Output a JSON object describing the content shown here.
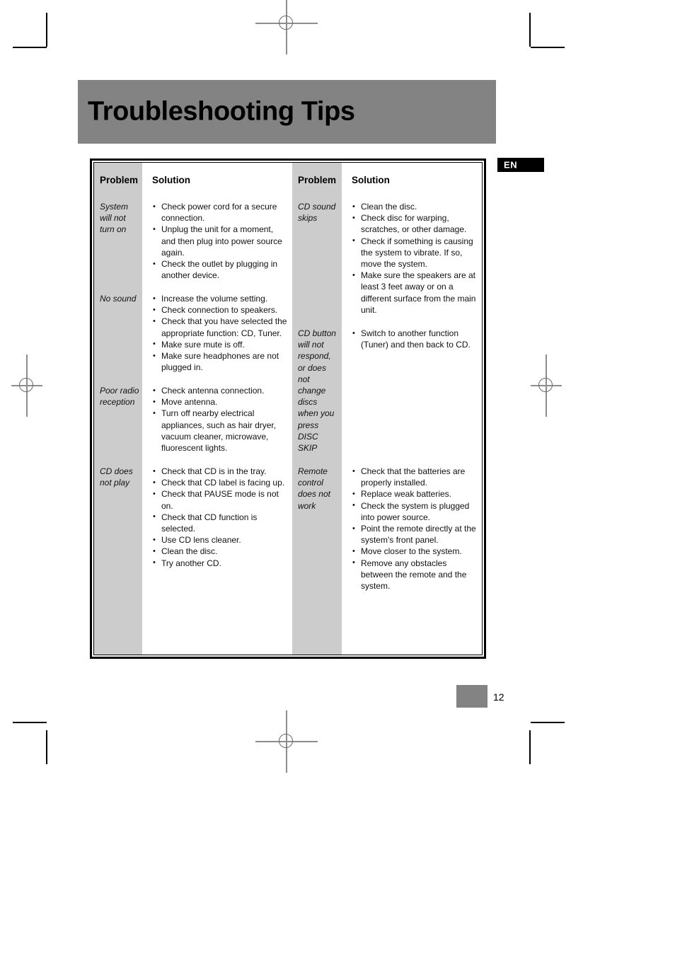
{
  "page": {
    "title": "Troubleshooting Tips",
    "language_badge": "EN",
    "page_number": "12",
    "colors": {
      "banner_gray": "#838383",
      "problem_column_gray": "#cccccc",
      "page_tab_gray": "#838383",
      "badge_black": "#000000"
    }
  },
  "table": {
    "headers": {
      "problem": "Problem",
      "solution": "Solution"
    },
    "left_column": [
      {
        "problem": "System will not turn on",
        "solutions": [
          "Check power cord for a secure connection.",
          "Unplug the unit for a moment, and then plug into power source again.",
          "Check the outlet by plugging in another device."
        ]
      },
      {
        "problem": "No sound",
        "solutions": [
          "Increase the volume setting.",
          "Check connection to speakers.",
          "Check that you have selected the appropriate function: CD, Tuner.",
          "Make sure mute is off.",
          "Make sure headphones are not plugged in."
        ]
      },
      {
        "problem": "Poor radio reception",
        "solutions": [
          "Check antenna connection.",
          "Move antenna.",
          "Turn off nearby electrical appliances, such as hair dryer, vacuum cleaner, microwave, fluorescent lights."
        ]
      },
      {
        "problem": "CD does not play",
        "solutions": [
          "Check that CD is in the tray.",
          "Check that CD label is facing up.",
          "Check that PAUSE mode is not on.",
          "Check that CD function is selected.",
          "Use CD lens cleaner.",
          "Clean the disc.",
          "Try another CD."
        ]
      }
    ],
    "right_column": [
      {
        "problem": "CD sound skips",
        "solutions": [
          "Clean the disc.",
          "Check disc for warping, scratches, or other damage.",
          "Check if something is causing the system to  vibrate. If so, move the  system.",
          "Make sure the speakers are at least 3 feet away or on a different surface from the main unit."
        ]
      },
      {
        "problem": "CD button will not respond, or does not change discs when you press DISC SKIP",
        "solutions": [
          "Switch to another function (Tuner) and then back to CD."
        ]
      },
      {
        "problem": "Remote control does not work",
        "solutions": [
          "Check that the batteries are properly installed.",
          "Replace weak batteries.",
          "Check the system is plugged into power source.",
          "Point the remote directly at the system's front panel.",
          "Move closer to the system.",
          "Remove any obstacles between the remote and the system."
        ]
      }
    ]
  }
}
